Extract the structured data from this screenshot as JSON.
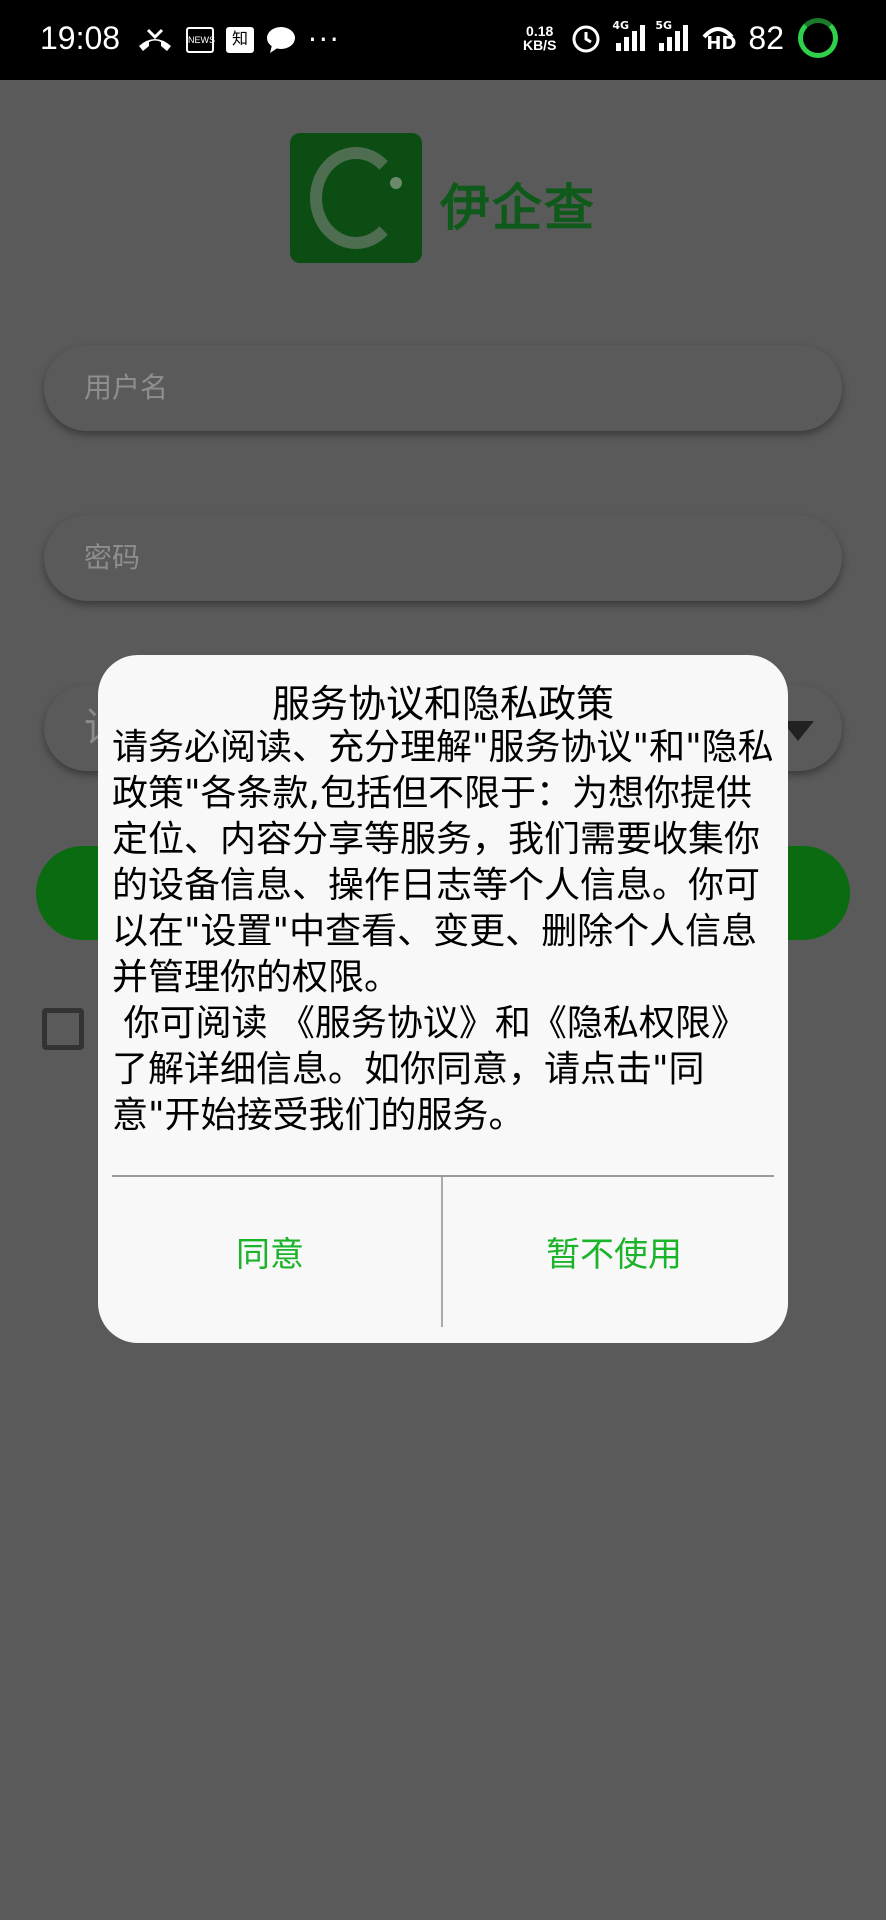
{
  "status_bar": {
    "time": "19:08",
    "speed_value": "0.18",
    "speed_unit": "KB/S",
    "net_4g": "4G",
    "net_5g": "5G",
    "hd": "HD",
    "battery": "82",
    "news_icon_text": "NEWS",
    "zhihu_icon_text": "知",
    "more": "···"
  },
  "app": {
    "brand": "伊企查",
    "username_placeholder": "用户名",
    "password_placeholder": "密码",
    "role_placeholder": "请"
  },
  "dialog": {
    "title": "服务协议和隐私政策",
    "paragraph1": "请务必阅读、充分理解\"服务协议\"和\"隐私政策\"各条款,包括但不限于：为想你提供定位、内容分享等服务，我们需要收集你的设备信息、操作日志等个人信息。你可以在\"设置\"中查看、变更、删除个人信息并管理你的权限。",
    "paragraph2": " 你可阅读 《服务协议》和《隐私权限》了解详细信息。如你同意，请点击\"同意\"开始接受我们的服务。",
    "agree": "同意",
    "decline": "暂不使用"
  },
  "colors": {
    "accent_green": "#1bb32a",
    "brand_green": "#0f5a1a",
    "overlay": "#5a5a5a"
  }
}
